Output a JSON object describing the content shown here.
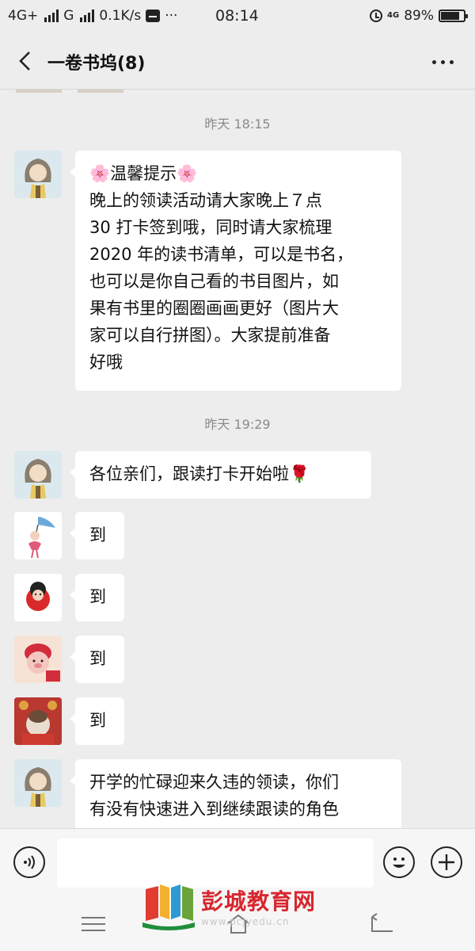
{
  "status_bar": {
    "network_1": "4G+",
    "network_2": "G",
    "speed": "0.1K/s",
    "more": "···",
    "time": "08:14",
    "net_badge": "4G",
    "battery_text": "89%",
    "battery_level": 0.89,
    "icons": [
      "signal-icon",
      "message-icon",
      "alarm-icon",
      "battery-icon"
    ]
  },
  "header": {
    "title": "一卷书坞(8)",
    "icons": [
      "back-arrow-icon",
      "more-dots-icon"
    ]
  },
  "messages": [
    {
      "timestamp": "昨天 18:15",
      "lines": [
        "🌸温馨提示🌸",
        "晚上的领读活动请大家晚上７点",
        "30 打卡签到哦，同时请大家梳理",
        "2020 年的读书清单，可以是书名，",
        "也可以是你自己看的书目图片，如",
        "果有书里的圈圈画画更好（图片大",
        "家可以自行拼图）。大家提前准备",
        "好哦"
      ]
    },
    {
      "timestamp": "昨天 19:29",
      "lines": [
        "各位亲们，跟读打卡开始啦🌹"
      ]
    },
    {
      "lines": [
        "到"
      ]
    },
    {
      "lines": [
        "到"
      ]
    },
    {
      "lines": [
        "到"
      ]
    },
    {
      "lines": [
        "到"
      ]
    },
    {
      "lines": [
        "开学的忙碌迎来久违的领读，你们",
        "有没有快速进入到继续跟读的角色"
      ]
    }
  ],
  "input_bar": {
    "icons": [
      "voice-icon",
      "emoji-icon",
      "plus-icon"
    ],
    "value": ""
  },
  "nav_bar": {
    "icons": [
      "menu-icon",
      "home-icon",
      "back-icon"
    ]
  },
  "watermark": {
    "brand": "彭城教育网",
    "url": "www.pcjyedu.cn"
  },
  "colors": {
    "background": "#ededed",
    "bubble": "#ffffff",
    "watermark_red": "#d8262e"
  }
}
